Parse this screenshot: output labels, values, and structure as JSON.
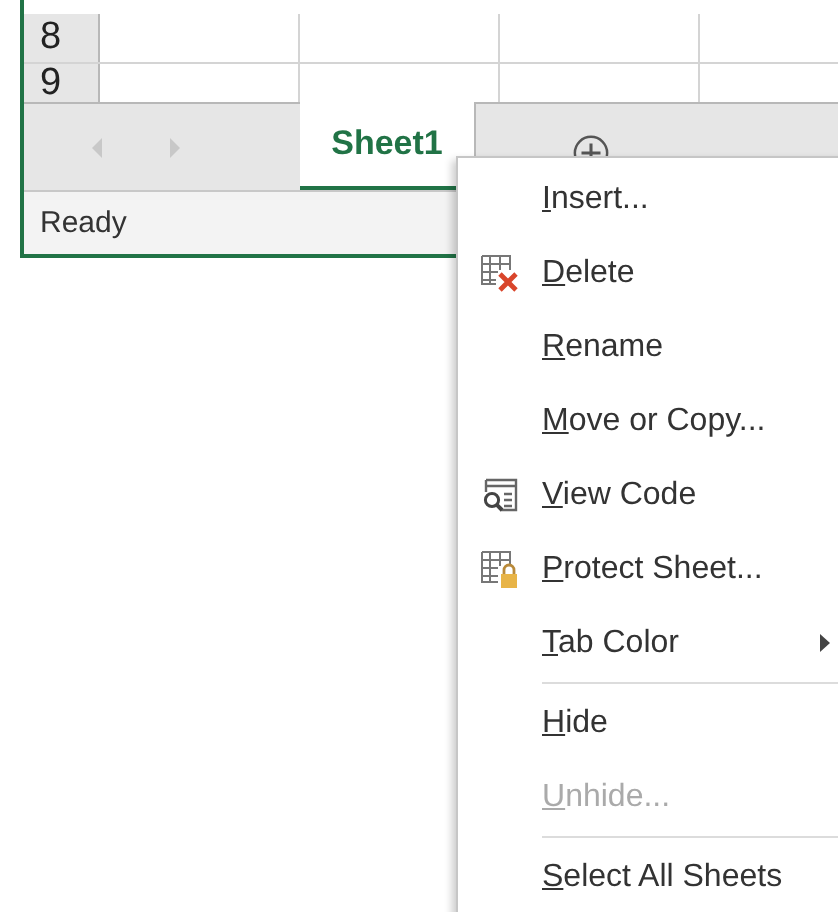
{
  "grid": {
    "rows": [
      {
        "header": "8"
      },
      {
        "header": "9"
      }
    ]
  },
  "sheet_tabs": [
    {
      "label": "Sheet1",
      "selected": true
    }
  ],
  "status_bar": {
    "text": "Ready"
  },
  "context_menu": {
    "items": [
      {
        "kind": "command",
        "label": "Insert...",
        "disabled": false,
        "submenu": false
      },
      {
        "kind": "command",
        "label": "Delete",
        "disabled": false,
        "submenu": false
      },
      {
        "kind": "command",
        "label": "Rename",
        "disabled": false,
        "submenu": false
      },
      {
        "kind": "command",
        "label": "Move or Copy...",
        "disabled": false,
        "submenu": false
      },
      {
        "kind": "command",
        "label": "View Code",
        "disabled": false,
        "submenu": false
      },
      {
        "kind": "command",
        "label": "Protect Sheet...",
        "disabled": false,
        "submenu": false
      },
      {
        "kind": "command",
        "label": "Tab Color",
        "disabled": false,
        "submenu": true
      },
      {
        "kind": "separator"
      },
      {
        "kind": "command",
        "label": "Hide",
        "disabled": false,
        "submenu": false
      },
      {
        "kind": "command",
        "label": "Unhide...",
        "disabled": true,
        "submenu": false
      },
      {
        "kind": "separator"
      },
      {
        "kind": "command",
        "label": "Select All Sheets",
        "disabled": false,
        "submenu": false
      }
    ]
  }
}
